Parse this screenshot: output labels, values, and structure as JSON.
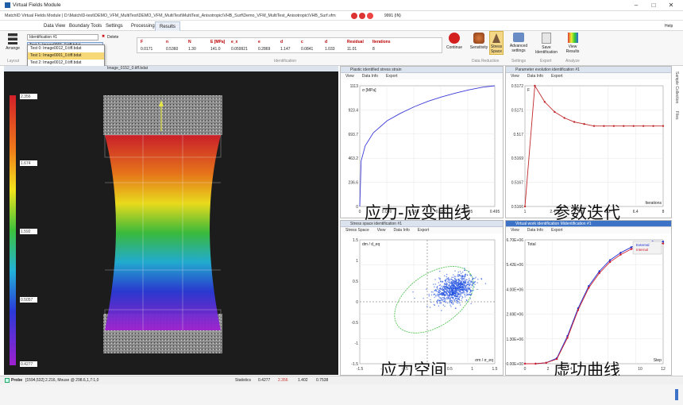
{
  "window": {
    "title": "Virtual Fields Module",
    "path": "MatchID Virtual Fields Module | D:\\MatchID-test\\DEMO_VFM_MultiTest\\DEMO_VFM_MultiTest\\MultiTest_Anisotropic\\VHB_Surf\\Demo_VFM_MultiTest_Anisotropic\\VHB_Surf.vfm",
    "fps": "9991 (IN)",
    "minimize": "–",
    "maximize": "□",
    "close": "✕"
  },
  "menu": {
    "items": [
      "File",
      "Data View",
      "Boundary Tools",
      "Settings",
      "Processing",
      "Results"
    ],
    "active": "Results",
    "help": "Help"
  },
  "ribbon": {
    "arrange_label": "Arrange",
    "layout_label": "Layout",
    "identification_value": "Identification #1",
    "delete_label": "Delete",
    "selected_test": "Test 1: Image0001_0.tiff.bdat",
    "dropdown_items": [
      "Test 0: Image0012_0.tiff.bdat",
      "Test 1: Image0001_0.tiff.bdat",
      "Test 2: Image0012_0.tiff.bdat"
    ],
    "dropdown_selected_index": 1,
    "table_headers": [
      "F",
      "n",
      "N",
      "E [MPa]",
      "e_x",
      "e",
      "d",
      "c",
      "d",
      "Residual",
      "Iterations"
    ],
    "table_values": [
      "0.0171",
      "0.5360",
      "1.30",
      "141.0",
      "0.059921",
      "0.2869",
      "1.147",
      "0.0841",
      "1.033",
      "11.01",
      "8"
    ],
    "identification_group": "Identification",
    "continue_label": "Continue",
    "sensitivity_label": "Sensitivity",
    "stress_space_label": "Stress Space",
    "data_reduction_group": "Data Reduction",
    "advanced_settings_label": "Advanced settings",
    "settings_group": "Settings",
    "save_identification_label": "Save Identification",
    "export_group": "Export",
    "view_results_label": "View Results",
    "analyze_group": "Analyze"
  },
  "image_panel": {
    "header": "Image_0152_0.tiff.bdat",
    "colorbar": {
      "max": "2.356",
      "v2": "1.674",
      "v3": "1.592",
      "v4": "0.5057",
      "min": "0.4277"
    },
    "colors": {
      "top": "#d21f2a",
      "bottom": "#a020d0",
      "bg": "#1c1c1c"
    }
  },
  "plots": [
    {
      "id": "stress-strain",
      "header": "Plastic identified stress strain",
      "tabs": [
        "View",
        "Data Info",
        "Export"
      ],
      "ylabel": "σ [MPa]",
      "overlay": "应力-应变曲线",
      "yticks": [
        "1113",
        "923.4",
        "693.7",
        "463.2",
        "236.6",
        "0"
      ],
      "xticks": [
        "0",
        "0.099",
        "0.188",
        "0.287",
        "0.395",
        "0.495"
      ],
      "chart_data": {
        "type": "line",
        "x": [
          0,
          0.005,
          0.02,
          0.05,
          0.1,
          0.15,
          0.2,
          0.25,
          0.3,
          0.35,
          0.4,
          0.45,
          0.495
        ],
        "y": [
          0,
          420,
          560,
          680,
          790,
          860,
          920,
          970,
          1010,
          1045,
          1075,
          1100,
          1113
        ],
        "ylim": [
          0,
          1113
        ],
        "xlim": [
          0,
          0.495
        ],
        "color": "#3a3ad8"
      }
    },
    {
      "id": "parameter-evolution",
      "header": "Parameter evolution identification #1",
      "tabs": [
        "View",
        "Data Info",
        "Export"
      ],
      "ylabel": "F",
      "overlay": "参数迭代",
      "yticks": [
        "0.5172",
        "0.5171",
        "0.517",
        "0.5169",
        "0.5167",
        "0.5166"
      ],
      "xticks": [
        "1",
        "2.4",
        "3.6",
        "5.2",
        "6.4",
        "8"
      ],
      "xlabel": "Iterations",
      "chart_data": {
        "type": "line",
        "x": [
          1,
          2,
          3,
          4,
          5,
          6,
          7,
          8,
          9,
          10,
          11,
          12,
          13,
          14,
          15
        ],
        "y": [
          0.5166,
          0.5172,
          0.51712,
          0.51707,
          0.51704,
          0.51702,
          0.51701,
          0.517,
          0.517,
          0.517,
          0.517,
          0.517,
          0.517,
          0.517,
          0.517
        ],
        "ylim": [
          0.5166,
          0.5172
        ],
        "xlim": [
          1,
          15
        ],
        "color": "#c0282c"
      }
    },
    {
      "id": "stress-space",
      "header": "Stress space identification #1",
      "tabs": [
        "Stress Space",
        "View",
        "Data Info",
        "Export"
      ],
      "ylabel": "dm / d_eq",
      "xlabel": "σm / σ_eq",
      "overlay": "应力空间",
      "yticks": [
        "1.5",
        "1",
        "0.5",
        "0",
        "-0.5",
        "-1",
        "-1.5"
      ],
      "xticks": [
        "-1.5",
        "-1",
        "-0.5",
        "0",
        "0.5",
        "1",
        "1.5"
      ],
      "chart_data": {
        "type": "scatter",
        "center": [
          0.6,
          0.3
        ],
        "spread": [
          0.35,
          0.25
        ],
        "xlim": [
          -1.5,
          1.5
        ],
        "ylim": [
          -1.5,
          1.5
        ],
        "color": "#2050e0",
        "ellipse_color": "#3fbf3f"
      }
    },
    {
      "id": "virtual-work",
      "header": "Virtual work identification Midentification #1",
      "tabs": [
        "View",
        "Data Info",
        "Export"
      ],
      "ylabel": "Total",
      "xlabel": "Step",
      "overlay": "虚功曲线",
      "legend": [
        "External",
        "Internal"
      ],
      "yticks": [
        "6.70E+06",
        "5.42E+06",
        "4.00E+06",
        "2.69E+06",
        "1.30E+06",
        "-0.00E+00"
      ],
      "xticks": [
        "0",
        "2",
        "4",
        "6",
        "8",
        "10",
        "12"
      ],
      "chart_data": {
        "type": "line",
        "x": [
          0,
          1,
          2,
          3,
          4,
          5,
          6,
          7,
          8,
          9,
          10,
          11,
          12,
          13
        ],
        "series": [
          {
            "name": "External",
            "values": [
              0,
              0,
              0.05,
              0.3,
              1.5,
              3.0,
              4.2,
              5.0,
              5.6,
              6.0,
              6.3,
              6.5,
              6.6,
              6.6
            ],
            "color": "#2030d0"
          },
          {
            "name": "Internal",
            "values": [
              0,
              0,
              0.05,
              0.25,
              1.4,
              2.9,
              4.1,
              4.9,
              5.5,
              5.9,
              6.2,
              6.4,
              6.5,
              6.5
            ],
            "color": "#d02030"
          }
        ],
        "ylim": [
          0,
          6.7
        ],
        "xlim": [
          0,
          13
        ]
      }
    }
  ],
  "status": {
    "probe": "Probe",
    "coords": "[1594,532] 2.216, Mouse @ 298.6,1,7:1,0",
    "statistics": "Statistics",
    "s1": "0.4277",
    "s2": "2.356",
    "s3": "1.402",
    "s4": "0.7538"
  },
  "right_tabs": [
    "Sample Collection",
    "Files"
  ]
}
